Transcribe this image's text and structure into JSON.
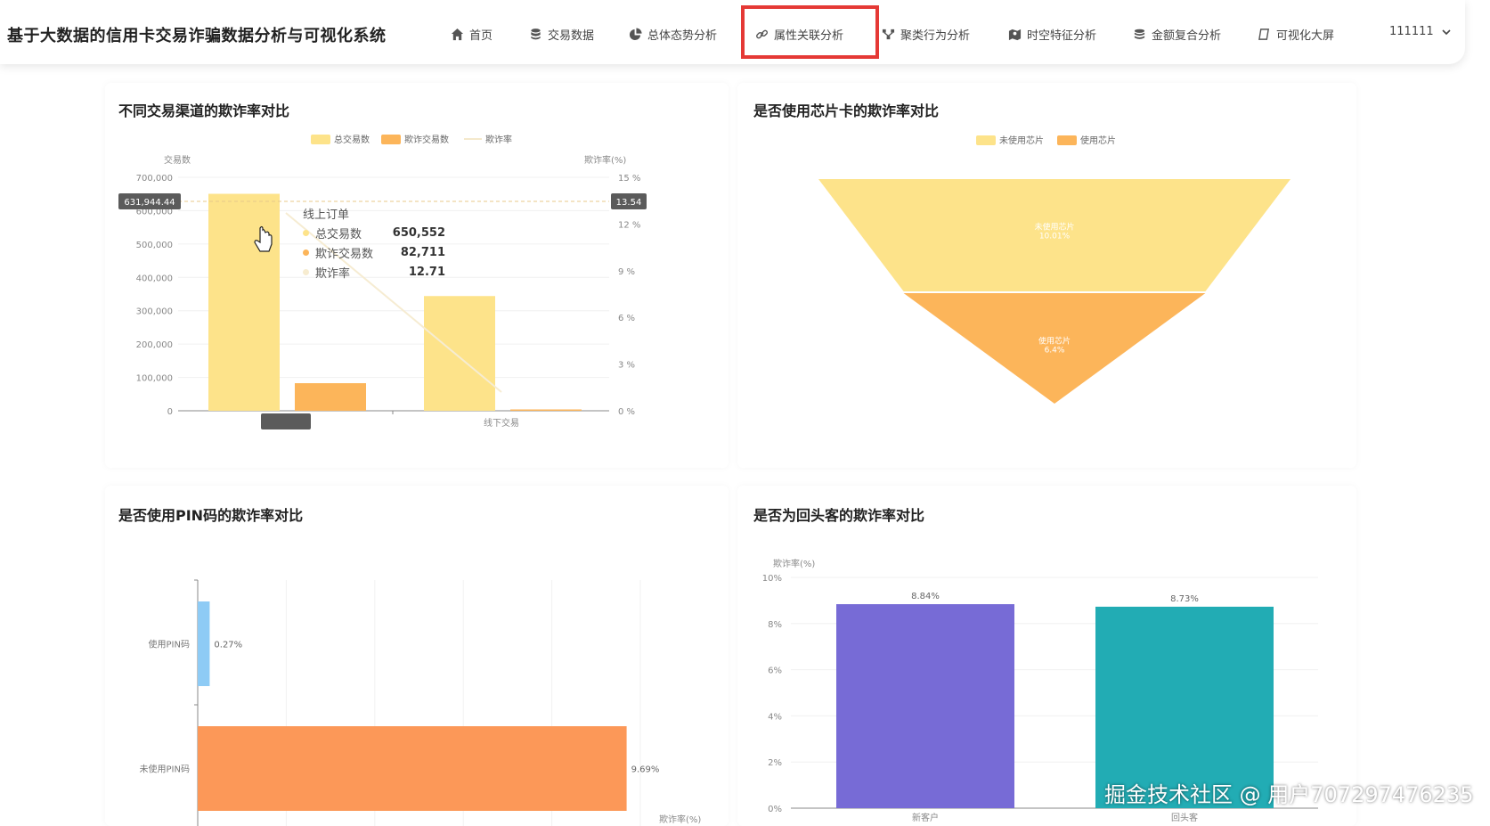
{
  "app_title": "基于大数据的信用卡交易诈骗数据分析与可视化系统",
  "nav": [
    {
      "label": "首页",
      "icon": "home-icon"
    },
    {
      "label": "交易数据",
      "icon": "database-icon"
    },
    {
      "label": "总体态势分析",
      "icon": "pie-icon"
    },
    {
      "label": "属性关联分析",
      "icon": "link-icon"
    },
    {
      "label": "聚类行为分析",
      "icon": "cluster-icon"
    },
    {
      "label": "时空特征分析",
      "icon": "map-icon"
    },
    {
      "label": "金额复合分析",
      "icon": "coins-icon"
    },
    {
      "label": "可视化大屏",
      "icon": "screen-icon"
    }
  ],
  "active_nav": "属性关联分析",
  "user": {
    "name": "111111"
  },
  "colors": {
    "yellow": "#fde38a",
    "orange": "#fcb55a",
    "blue": "#8ecbf5",
    "coral": "#fc9858",
    "purple": "#776bd6",
    "teal": "#22acb4"
  },
  "watermark": "掘金技术社区 @ 用户707297476235",
  "charts": {
    "channel": {
      "title": "不同交易渠道的欺诈率对比",
      "legend": [
        "总交易数",
        "欺诈交易数",
        "欺诈率"
      ],
      "y_left_label": "交易数",
      "y_right_label": "欺诈率(%)",
      "cursor_left_value": "631,944.44",
      "cursor_right_value": "13.54",
      "tooltip": {
        "title": "线上订单",
        "rows": [
          {
            "label": "总交易数",
            "value": "650,552"
          },
          {
            "label": "欺诈交易数",
            "value": "82,711"
          },
          {
            "label": "欺诈率",
            "value": "12.71"
          }
        ]
      }
    },
    "chip": {
      "title": "是否使用芯片卡的欺诈率对比",
      "legend": [
        "未使用芯片",
        "使用芯片"
      ]
    },
    "pin": {
      "title": "是否使用PIN码的欺诈率对比",
      "x_label": "欺诈率(%)"
    },
    "repeat": {
      "title": "是否为回头客的欺诈率对比",
      "y_label": "欺诈率(%)"
    }
  },
  "chart_data": [
    {
      "type": "bar",
      "title": "不同交易渠道的欺诈率对比",
      "categories": [
        "线上订单",
        "线下交易"
      ],
      "series": [
        {
          "name": "总交易数",
          "values": [
            650552,
            344000
          ]
        },
        {
          "name": "欺诈交易数",
          "values": [
            82711,
            4000
          ]
        },
        {
          "name": "欺诈率",
          "values": [
            12.71,
            1.2
          ]
        }
      ],
      "ylim": [
        0,
        700000
      ],
      "ylim_right": [
        0,
        15
      ],
      "yticks": [
        "0",
        "100,000",
        "200,000",
        "300,000",
        "400,000",
        "500,000",
        "600,000",
        "700,000"
      ],
      "yticks_right": [
        "0 %",
        "3 %",
        "6 %",
        "9 %",
        "12 %",
        "15 %"
      ]
    },
    {
      "type": "funnel",
      "title": "是否使用芯片卡的欺诈率对比",
      "categories": [
        "未使用芯片",
        "使用芯片"
      ],
      "values": [
        10.01,
        6.4
      ],
      "labels": [
        "10.01%",
        "6.4%"
      ]
    },
    {
      "type": "bar",
      "title": "是否使用PIN码的欺诈率对比",
      "orientation": "horizontal",
      "categories": [
        "使用PIN码",
        "未使用PIN码"
      ],
      "values": [
        0.27,
        9.69
      ],
      "labels": [
        "0.27%",
        "9.69%"
      ]
    },
    {
      "type": "bar",
      "title": "是否为回头客的欺诈率对比",
      "categories": [
        "新客户",
        "回头客"
      ],
      "values": [
        8.84,
        8.73
      ],
      "labels": [
        "8.84%",
        "8.73%"
      ],
      "ylim": [
        0,
        10
      ],
      "yticks": [
        "0%",
        "2%",
        "4%",
        "6%",
        "8%",
        "10%"
      ]
    }
  ]
}
